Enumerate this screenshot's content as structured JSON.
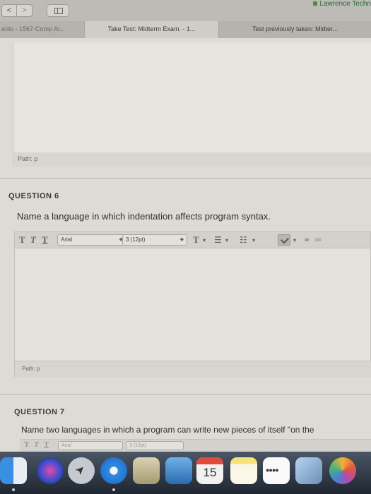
{
  "browser": {
    "back_label": "<",
    "forward_label": ">",
    "site": "Lawrence Techn",
    "tabs": [
      {
        "label": "ents - 1567-Comp Ar..."
      },
      {
        "label": "Take Test: Midterm Exam. - 1..."
      },
      {
        "label": "Test previously taken: Midter..."
      }
    ]
  },
  "prev_editor": {
    "path": "Path: p"
  },
  "question6": {
    "label": "QUESTION 6",
    "text": "Name a language in which indentation affects program syntax.",
    "toolbar": {
      "bold": "T",
      "italic": "T",
      "underline": "T",
      "font_family": "Arial",
      "font_size": "3 (12pt)",
      "text_color": "T"
    },
    "path": "Path: p"
  },
  "question7": {
    "label": "QUESTION 7",
    "text": "Name two languages in which a program can write new pieces of itself \"on the",
    "toolbar": {
      "font_family": "Arial",
      "font_size": "3 (12pt)"
    }
  },
  "dock": {
    "calendar_month": "OCT",
    "calendar_day": "15"
  }
}
